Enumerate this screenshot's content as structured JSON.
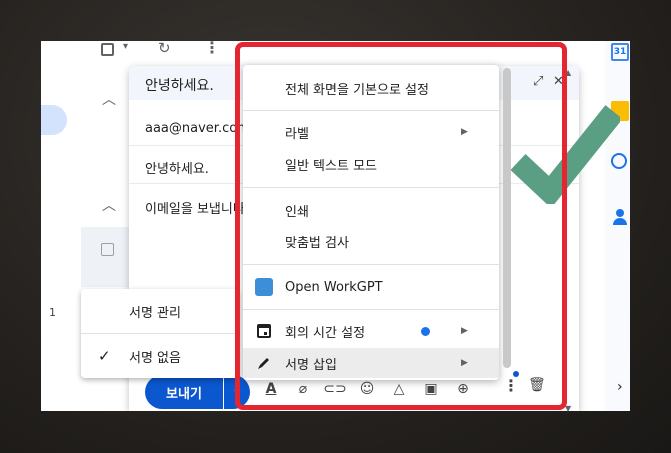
{
  "gmail": {
    "list_row_number": "1"
  },
  "compose": {
    "title": "안녕하세요.",
    "to": "aaa@naver.com",
    "subject": "안녕하세요.",
    "body": "이메일을 보냅니다",
    "send_label": "보내기"
  },
  "menu": {
    "items": [
      {
        "label": "전체 화면을 기본으로 설정"
      },
      {
        "label": "라벨"
      },
      {
        "label": "일반 텍스트 모드"
      },
      {
        "label": "인쇄"
      },
      {
        "label": "맞춤법 검사"
      },
      {
        "label": "Open WorkGPT"
      },
      {
        "label": "회의 시간 설정"
      },
      {
        "label": "서명 삽입"
      }
    ]
  },
  "signature_menu": {
    "items": [
      {
        "label": "서명 관리"
      },
      {
        "label": "서명 없음"
      }
    ]
  },
  "side_panel": {
    "calendar_day": "31"
  },
  "colors": {
    "accent_blue": "#0b57d0",
    "highlight_red": "#e3262f",
    "check_green": "#5a9e84"
  },
  "icons": [
    "checkbox-icon",
    "refresh-icon",
    "more-vert-icon",
    "expand-icon",
    "close-icon",
    "text-format-icon",
    "attach-icon",
    "link-icon",
    "emoji-icon",
    "drive-icon",
    "photo-icon",
    "lock-clock-icon",
    "trash-icon",
    "calendar-icon",
    "pen-icon",
    "checkmark-icon",
    "workgpt-icon"
  ]
}
